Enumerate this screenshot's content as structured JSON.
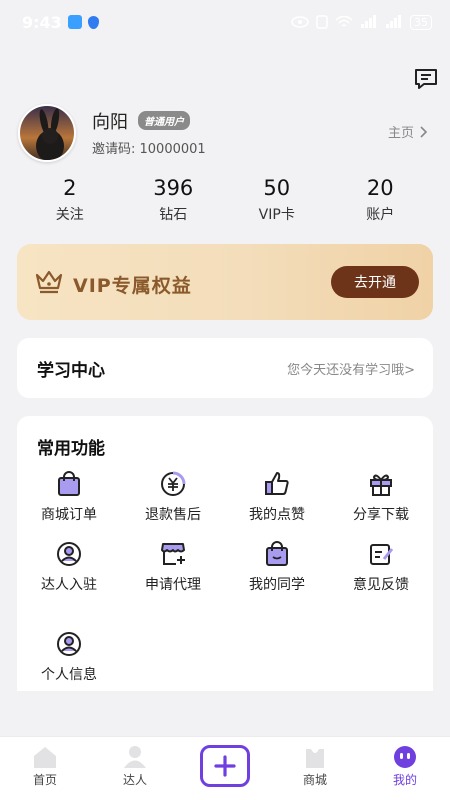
{
  "status_bar": {
    "time": "9:43",
    "battery": "35"
  },
  "profile": {
    "name": "向阳",
    "badge": "普通用户",
    "invite_code": "邀请码: 10000001",
    "home_link": "主页"
  },
  "stats": [
    {
      "value": "2",
      "label": "关注"
    },
    {
      "value": "396",
      "label": "钻石"
    },
    {
      "value": "50",
      "label": "VIP卡"
    },
    {
      "value": "20",
      "label": "账户"
    }
  ],
  "vip": {
    "title": "VIP专属权益",
    "button": "去开通"
  },
  "study": {
    "title": "学习中心",
    "hint": "您今天还没有学习哦>"
  },
  "functions": {
    "title": "常用功能",
    "items": [
      {
        "label": "商城订单",
        "icon": "shopping-bag-icon"
      },
      {
        "label": "退款售后",
        "icon": "yen-refund-icon"
      },
      {
        "label": "我的点赞",
        "icon": "thumbs-up-icon"
      },
      {
        "label": "分享下载",
        "icon": "gift-icon"
      },
      {
        "label": "达人入驻",
        "icon": "user-circle-icon"
      },
      {
        "label": "申请代理",
        "icon": "store-add-icon"
      },
      {
        "label": "我的同学",
        "icon": "classmate-bag-icon"
      },
      {
        "label": "意见反馈",
        "icon": "feedback-edit-icon"
      },
      {
        "label": "个人信息",
        "icon": "profile-icon"
      }
    ]
  },
  "tabbar": [
    {
      "label": "首页",
      "icon": "home-icon"
    },
    {
      "label": "达人",
      "icon": "expert-icon"
    },
    {
      "label": "",
      "icon": "plus-icon"
    },
    {
      "label": "商城",
      "icon": "mall-bag-icon"
    },
    {
      "label": "我的",
      "icon": "mine-face-icon",
      "active": true
    }
  ],
  "colors": {
    "accent": "#6f3fe0",
    "icon_fill": "#a99cf0",
    "vip_text": "#8a5a2c",
    "vip_button": "#6e3419",
    "background": "#f2f2f4"
  }
}
